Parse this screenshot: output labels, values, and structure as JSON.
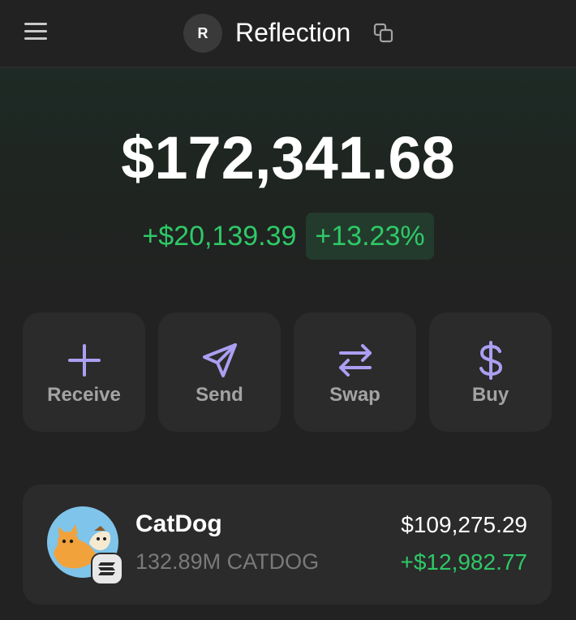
{
  "header": {
    "avatar_initial": "R",
    "account_name": "Reflection"
  },
  "portfolio": {
    "balance": "$172,341.68",
    "change_amount": "+$20,139.39",
    "change_percent": "+13.23%"
  },
  "actions": [
    {
      "label": "Receive",
      "icon": "plus-icon"
    },
    {
      "label": "Send",
      "icon": "send-icon"
    },
    {
      "label": "Swap",
      "icon": "swap-icon"
    },
    {
      "label": "Buy",
      "icon": "dollar-icon"
    }
  ],
  "tokens": [
    {
      "name": "CatDog",
      "amount": "132.89M CATDOG",
      "value": "$109,275.29",
      "change": "+$12,982.77",
      "chain_badge": "solana-icon"
    }
  ],
  "colors": {
    "background": "#222222",
    "card": "#2b2b2b",
    "accent": "#ab9ff2",
    "positive": "#2ec967",
    "muted": "#a3a3a3"
  }
}
